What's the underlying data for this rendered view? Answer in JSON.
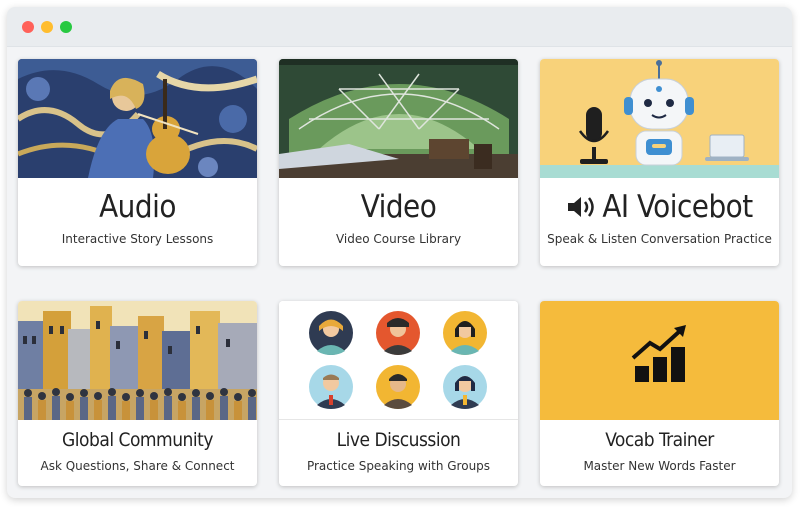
{
  "colors": {
    "window_bg": "#f3f4f6",
    "card_bg": "#ffffff",
    "voicebot_bg": "#f8d27a",
    "vocab_bg": "#f5bb3c",
    "text": "#222222"
  },
  "cards": [
    {
      "title": "Audio",
      "subtitle": "Interactive Story Lessons",
      "image": "violin-player-illustration"
    },
    {
      "title": "Video",
      "subtitle": "Video Course Library",
      "image": "geodesic-dome-interior-photo"
    },
    {
      "title": "AI Voicebot",
      "subtitle": "Speak & Listen Conversation Practice",
      "icon": "speaker-icon",
      "image": "robot-with-microphone-illustration"
    },
    {
      "title": "Global Community",
      "subtitle": "Ask Questions, Share & Connect",
      "image": "crowd-in-city-illustration"
    },
    {
      "title": "Live Discussion",
      "subtitle": "Practice Speaking with Groups",
      "image": "avatar-grid-illustration"
    },
    {
      "title": "Vocab Trainer",
      "subtitle": "Master New Words Faster",
      "icon": "growth-chart-icon"
    }
  ]
}
